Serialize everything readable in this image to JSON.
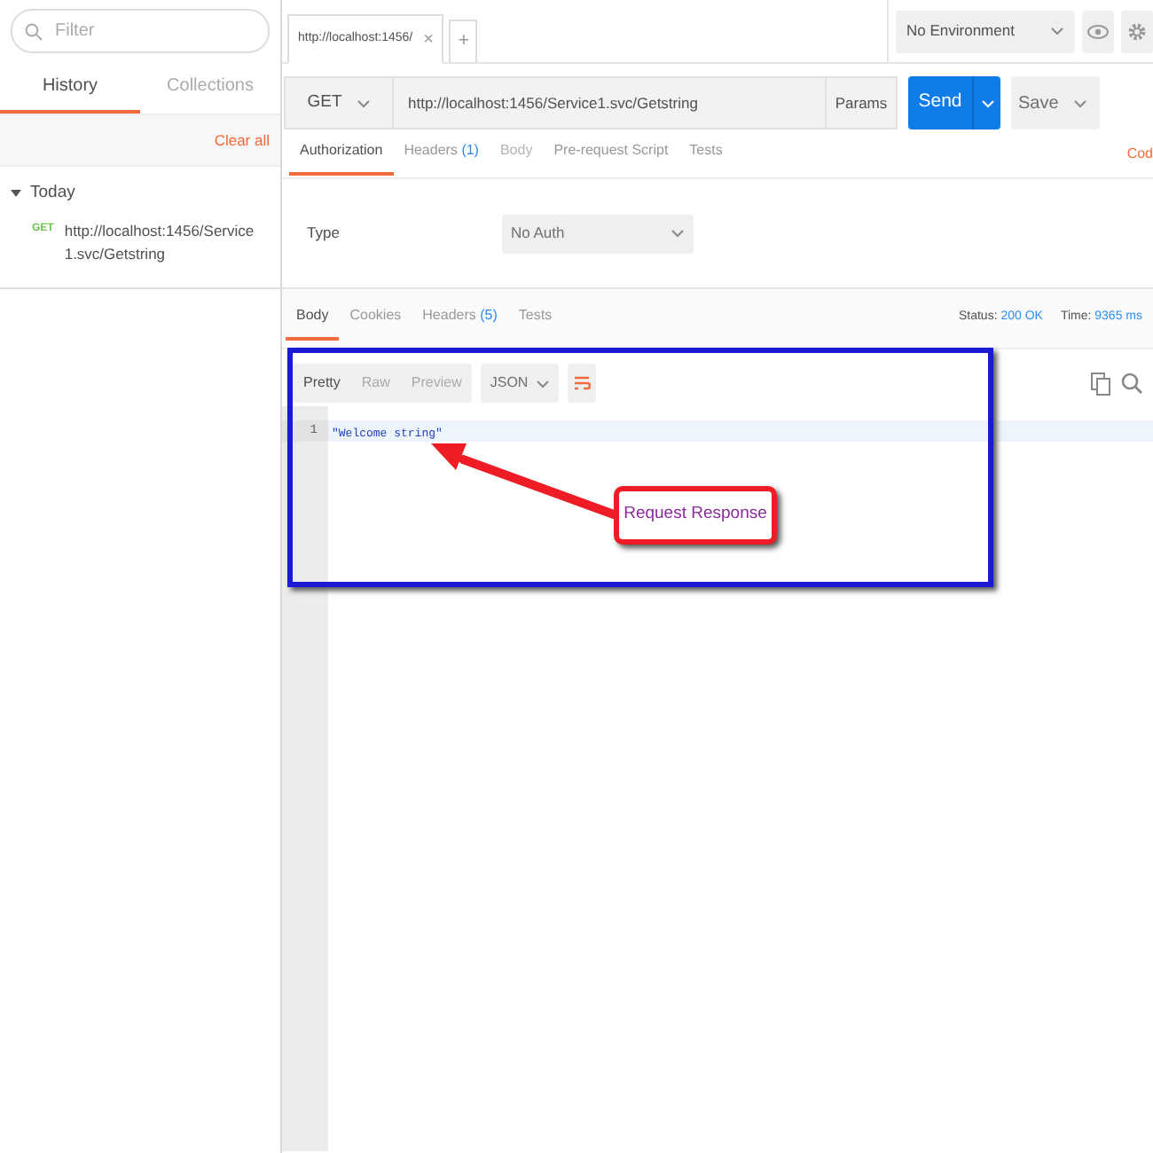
{
  "sidebar": {
    "search": {
      "placeholder": "Filter"
    },
    "tabs": [
      {
        "label": "History",
        "selected": true
      },
      {
        "label": "Collections",
        "selected": false
      }
    ],
    "clear_all": "Clear all",
    "groups": [
      {
        "label": "Today",
        "expanded": true,
        "items": [
          {
            "method": "GET",
            "url": "http://localhost:1456/Service1.svc/Getstring"
          }
        ]
      }
    ]
  },
  "request_tabs": [
    {
      "label": "http://localhost:1456/",
      "close": "×",
      "selected": true
    }
  ],
  "new_tab": "+",
  "environment": {
    "value": "No Environment"
  },
  "request": {
    "method": "GET",
    "url": "http://localhost:1456/Service1.svc/Getstring",
    "params": "Params",
    "send": "Send",
    "save": "Save"
  },
  "request_sections": [
    {
      "label": "Authorization",
      "selected": true,
      "disabled": false
    },
    {
      "label": "Headers",
      "count": "(1)",
      "selected": false,
      "disabled": false
    },
    {
      "label": "Body",
      "selected": false,
      "disabled": true
    },
    {
      "label": "Pre-request Script",
      "selected": false,
      "disabled": false
    },
    {
      "label": "Tests",
      "selected": false,
      "disabled": false
    }
  ],
  "code_link": "Cod",
  "auth": {
    "label": "Type",
    "value": "No Auth"
  },
  "response_sections": [
    {
      "label": "Body",
      "selected": true
    },
    {
      "label": "Cookies",
      "selected": false
    },
    {
      "label": "Headers",
      "count": "(5)",
      "selected": false
    },
    {
      "label": "Tests",
      "selected": false
    }
  ],
  "status": {
    "label": "Status:",
    "value": "200 OK"
  },
  "time": {
    "label": "Time:",
    "value": "9365 ms"
  },
  "view_modes": [
    {
      "label": "Pretty",
      "selected": true
    },
    {
      "label": "Raw",
      "selected": false
    },
    {
      "label": "Preview",
      "selected": false
    }
  ],
  "format": "JSON",
  "editor": {
    "lines": [
      {
        "number": "1",
        "text": "\"Welcome string\""
      }
    ]
  },
  "annotation": {
    "text": "Request Response"
  }
}
